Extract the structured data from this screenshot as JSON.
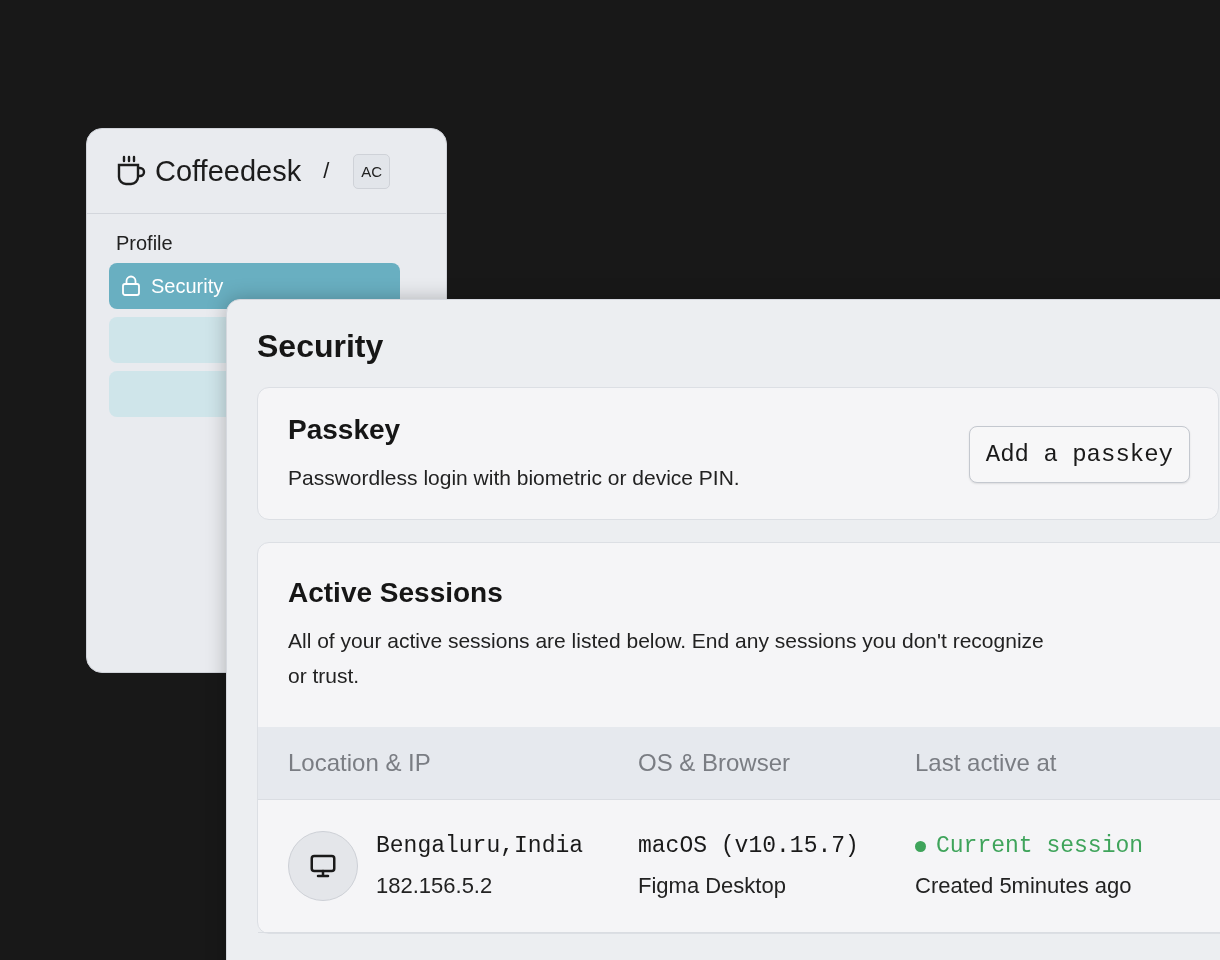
{
  "sidebar_window": {
    "brand": "Coffeedesk",
    "separator": "/",
    "workspace_badge": "AC",
    "section_label": "Profile",
    "items": [
      {
        "label": "Security",
        "selected": true
      },
      {
        "selected": false
      },
      {
        "selected": false
      }
    ]
  },
  "main_window": {
    "title": "Security",
    "passkey": {
      "title": "Passkey",
      "description": "Passwordless login with biometric or device PIN.",
      "button": "Add a passkey"
    },
    "sessions": {
      "title": "Active Sessions",
      "description": "All of your active sessions are listed below. End any sessions you don't recognize or trust.",
      "columns": [
        "Location & IP",
        "OS & Browser",
        "Last active at"
      ],
      "rows": [
        {
          "location": "Bengaluru,India",
          "ip": "182.156.5.2",
          "os": "macOS (v10.15.7)",
          "browser": "Figma Desktop",
          "status": "Current session",
          "color": "#3fa45b",
          "created": "Created 5minutes ago"
        }
      ]
    }
  }
}
